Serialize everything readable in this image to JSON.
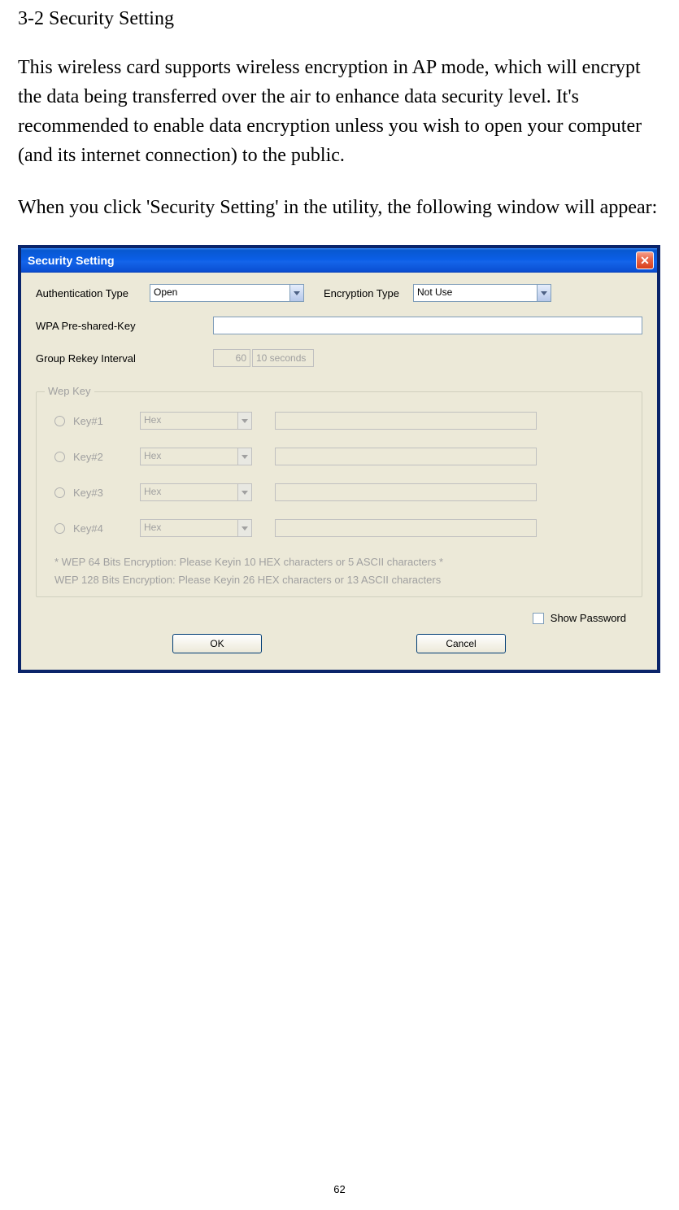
{
  "doc": {
    "heading": "3-2 Security Setting",
    "para1": "This wireless card supports wireless encryption in AP mode, which will encrypt the data being transferred over the air to enhance data security level. It's recommended to enable data encryption unless you wish to open your computer (and its internet connection) to the public.",
    "para2": "When you click 'Security Setting' in the utility, the following window will appear:",
    "page_number": "62"
  },
  "dialog": {
    "title": "Security Setting",
    "labels": {
      "auth_type": "Authentication Type",
      "enc_type": "Encryption Type",
      "wpa_psk": "WPA Pre-shared-Key",
      "group_rekey": "Group Rekey Interval",
      "wep_group": "Wep Key",
      "show_password": "Show Password"
    },
    "values": {
      "auth_type": "Open",
      "enc_type": "Not Use",
      "wpa_psk": "",
      "group_rekey_num": "60",
      "group_rekey_unit": "10 seconds"
    },
    "wep": {
      "keys": [
        {
          "label": "Key#1",
          "format": "Hex",
          "value": ""
        },
        {
          "label": "Key#2",
          "format": "Hex",
          "value": ""
        },
        {
          "label": "Key#3",
          "format": "Hex",
          "value": ""
        },
        {
          "label": "Key#4",
          "format": "Hex",
          "value": ""
        }
      ],
      "hint1": "* WEP 64 Bits Encryption:  Please Keyin 10 HEX characters or 5 ASCII characters *",
      "hint2": "WEP 128 Bits Encryption:  Please Keyin 26 HEX characters or 13 ASCII characters"
    },
    "buttons": {
      "ok": "OK",
      "cancel": "Cancel"
    }
  }
}
